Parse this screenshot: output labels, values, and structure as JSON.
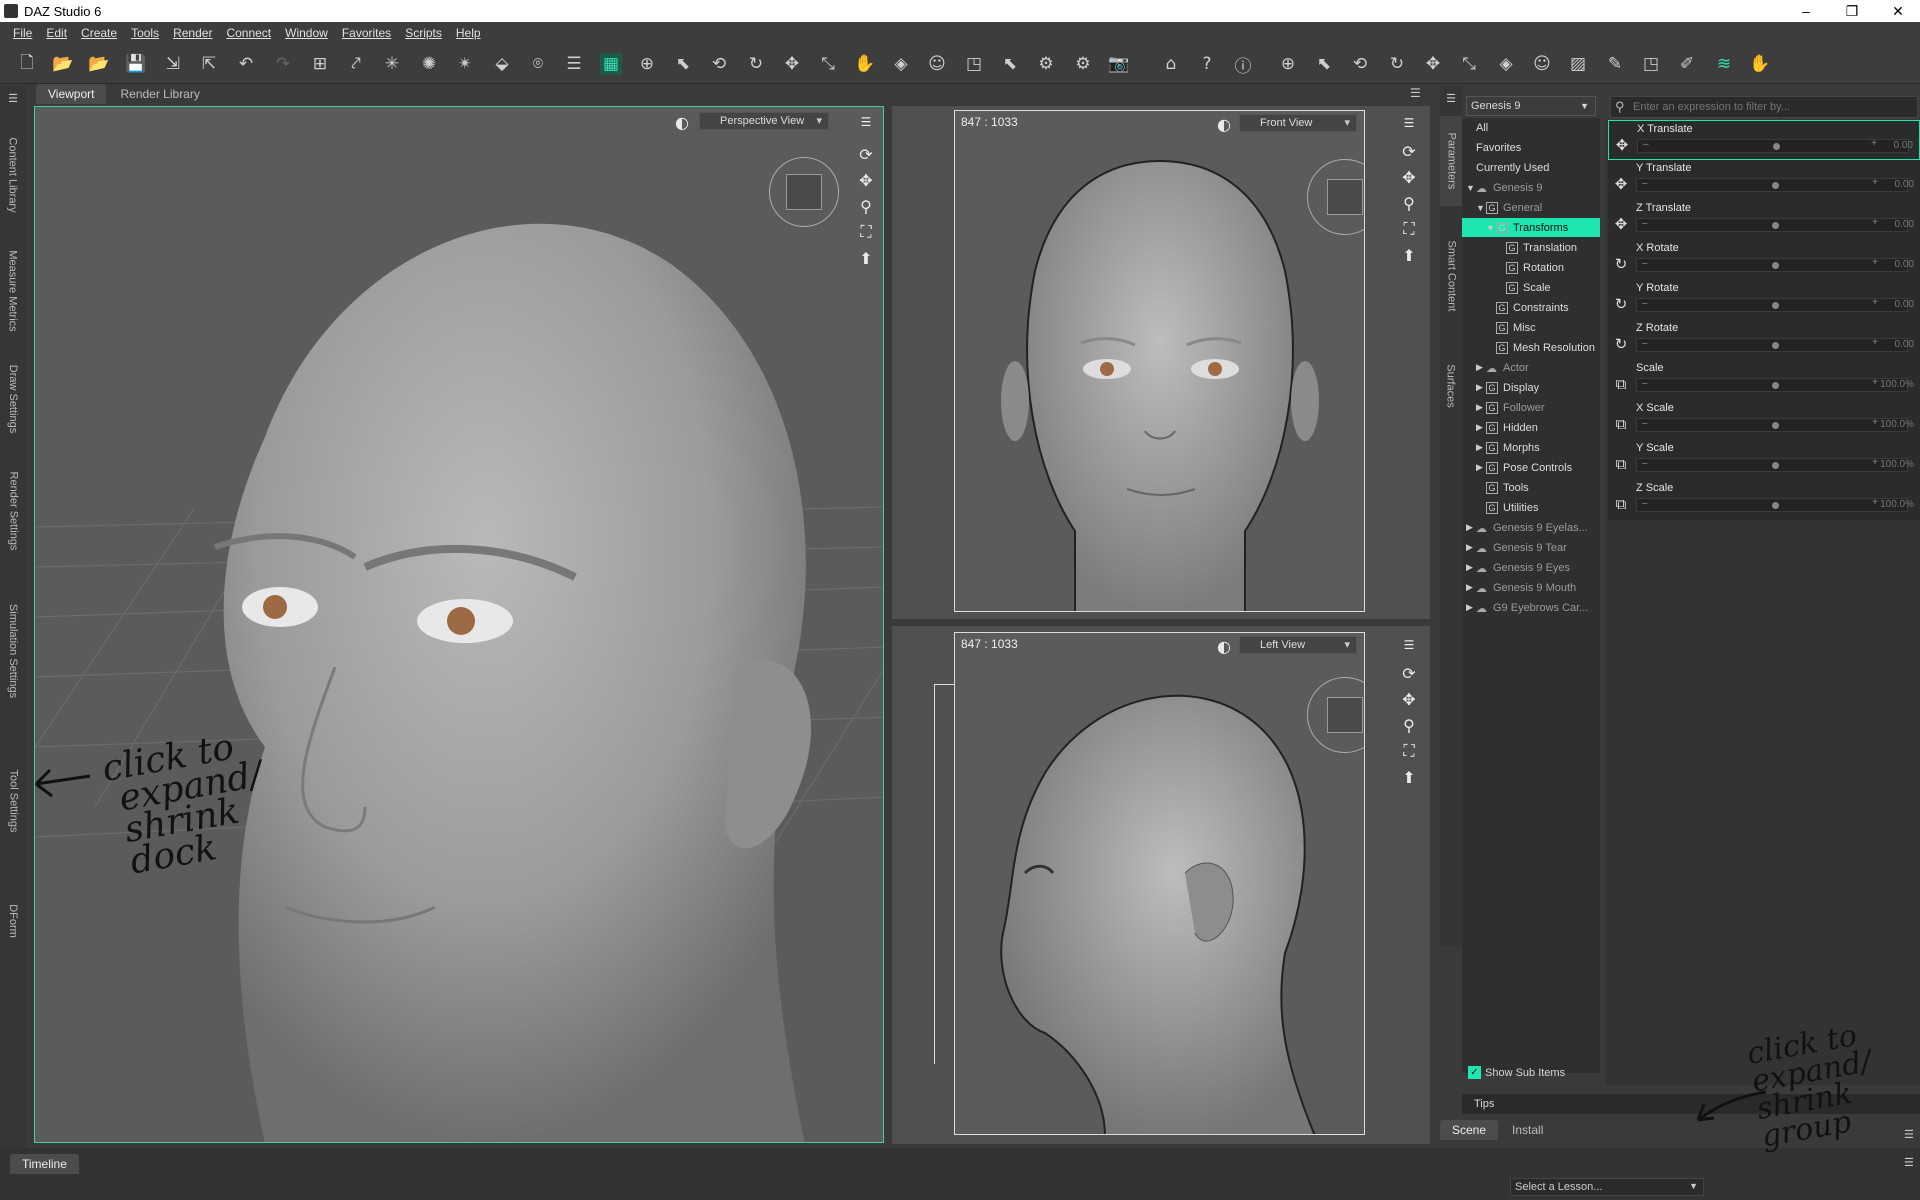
{
  "window": {
    "title": "DAZ Studio 6",
    "controls": [
      "–",
      "❐",
      "✕"
    ]
  },
  "menu": [
    "File",
    "Edit",
    "Create",
    "Tools",
    "Render",
    "Connect",
    "Window",
    "Favorites",
    "Scripts",
    "Help"
  ],
  "left_dock_tabs": [
    "Content Library",
    "Measure Metrics",
    "Draw Settings",
    "Render Settings",
    "Simulation Settings",
    "Tool Settings",
    "DForm"
  ],
  "viewport_tabs": [
    "Viewport",
    "Render Library"
  ],
  "viewports": {
    "main": {
      "view": "Perspective View"
    },
    "top_right": {
      "dims": "847 : 1033",
      "view": "Front View"
    },
    "bottom_right": {
      "dims": "847 : 1033",
      "view": "Left View"
    }
  },
  "right_vertical_tabs": [
    "Parameters",
    "Smart Content",
    "Surfaces"
  ],
  "scene_selector": "Genesis 9",
  "filter_placeholder": "Enter an expression to filter by...",
  "tree": [
    {
      "label": "All",
      "level": 0
    },
    {
      "label": "Favorites",
      "level": 0
    },
    {
      "label": "Currently Used",
      "level": 0
    },
    {
      "label": "Genesis 9",
      "level": 0,
      "arrow": "▼",
      "icon": "figure",
      "dim": true
    },
    {
      "label": "General",
      "level": 1,
      "arrow": "▼",
      "icon": "group",
      "dim": true
    },
    {
      "label": "Transforms",
      "level": 2,
      "arrow": "▼",
      "icon": "group",
      "selected": true
    },
    {
      "label": "Translation",
      "level": 3,
      "icon": "group"
    },
    {
      "label": "Rotation",
      "level": 3,
      "icon": "group"
    },
    {
      "label": "Scale",
      "level": 3,
      "icon": "group"
    },
    {
      "label": "Constraints",
      "level": 2,
      "icon": "group"
    },
    {
      "label": "Misc",
      "level": 2,
      "icon": "group"
    },
    {
      "label": "Mesh Resolution",
      "level": 2,
      "icon": "group"
    },
    {
      "label": "Actor",
      "level": 1,
      "arrow": "▶",
      "icon": "figure",
      "dim": true
    },
    {
      "label": "Display",
      "level": 1,
      "arrow": "▶",
      "icon": "group"
    },
    {
      "label": "Follower",
      "level": 1,
      "arrow": "▶",
      "icon": "group",
      "dim": true
    },
    {
      "label": "Hidden",
      "level": 1,
      "arrow": "▶",
      "icon": "group"
    },
    {
      "label": "Morphs",
      "level": 1,
      "arrow": "▶",
      "icon": "group"
    },
    {
      "label": "Pose Controls",
      "level": 1,
      "arrow": "▶",
      "icon": "group"
    },
    {
      "label": "Tools",
      "level": 1,
      "icon": "group"
    },
    {
      "label": "Utilities",
      "level": 1,
      "icon": "group"
    },
    {
      "label": "Genesis 9 Eyelas...",
      "level": 0,
      "arrow": "▶",
      "icon": "figure",
      "dim": true
    },
    {
      "label": "Genesis 9 Tear",
      "level": 0,
      "arrow": "▶",
      "icon": "figure",
      "dim": true
    },
    {
      "label": "Genesis 9 Eyes",
      "level": 0,
      "arrow": "▶",
      "icon": "figure",
      "dim": true
    },
    {
      "label": "Genesis 9 Mouth",
      "level": 0,
      "arrow": "▶",
      "icon": "figure",
      "dim": true
    },
    {
      "label": "G9 Eyebrows Car...",
      "level": 0,
      "arrow": "▶",
      "icon": "figure",
      "dim": true
    }
  ],
  "parameters": [
    {
      "label": "X Translate",
      "icon": "move",
      "value": "0.00"
    },
    {
      "label": "Y Translate",
      "icon": "move",
      "value": "0.00"
    },
    {
      "label": "Z Translate",
      "icon": "move",
      "value": "0.00"
    },
    {
      "label": "X Rotate",
      "icon": "rotate",
      "value": "0.00"
    },
    {
      "label": "Y Rotate",
      "icon": "rotate",
      "value": "0.00"
    },
    {
      "label": "Z Rotate",
      "icon": "rotate",
      "value": "0.00"
    },
    {
      "label": "Scale",
      "icon": "scale",
      "value": "100.0%"
    },
    {
      "label": "X Scale",
      "icon": "scale",
      "value": "100.0%"
    },
    {
      "label": "Y Scale",
      "icon": "scale",
      "value": "100.0%"
    },
    {
      "label": "Z Scale",
      "icon": "scale",
      "value": "100.0%"
    }
  ],
  "show_sub_items": {
    "label": "Show Sub Items",
    "checked": true
  },
  "tips_tab": "Tips",
  "bottom_tabs": [
    "Scene",
    "Install"
  ],
  "timeline_tab": "Timeline",
  "lesson_select": "Select a Lesson...",
  "annotations": {
    "left": "click to\n expand/\n shrink\n dock",
    "right": "click to\nexpand/\nshrink\ngroup"
  },
  "colors": {
    "accent": "#1ee6b0",
    "viewport_border": "#3fd0a0"
  }
}
